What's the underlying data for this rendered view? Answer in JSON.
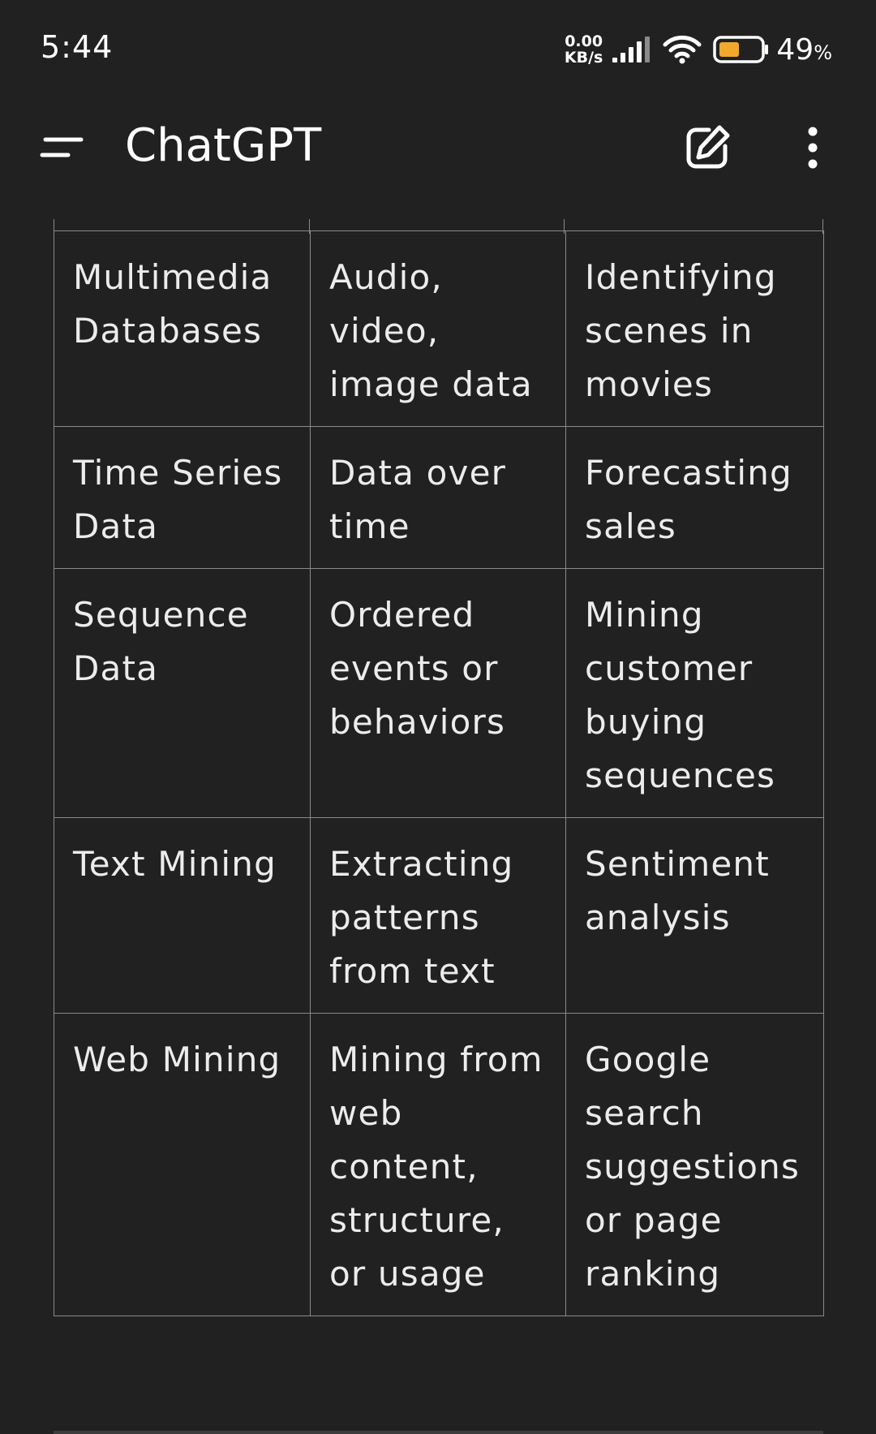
{
  "status_bar": {
    "time": "5:44",
    "net_speed_value": "0.00",
    "net_speed_unit": "KB/s",
    "battery_percent": "49",
    "battery_percent_sign": "%",
    "battery_level": 0.49,
    "battery_color": "#f0a92c",
    "icons": [
      "signal-icon",
      "wifi-icon",
      "battery-icon"
    ]
  },
  "header": {
    "title": "ChatGPT",
    "icons": [
      "menu-icon",
      "compose-icon",
      "more-vert-icon"
    ]
  },
  "table": {
    "rows": [
      [
        "Multimedia Databases",
        "Audio, video, image data",
        "Identifying scenes in movies"
      ],
      [
        "Time Series Data",
        "Data over time",
        "Forecasting sales"
      ],
      [
        "Sequence Data",
        "Ordered events or behaviors",
        "Mining customer buying sequences"
      ],
      [
        "Text Mining",
        "Extracting patterns from text",
        "Sentiment analysis"
      ],
      [
        "Web Mining",
        "Mining from web content, structure, or usage",
        "Google search suggestions or page ranking"
      ]
    ]
  },
  "colors": {
    "background": "#212121",
    "text": "#ececec",
    "border": "#8a8a8a"
  }
}
